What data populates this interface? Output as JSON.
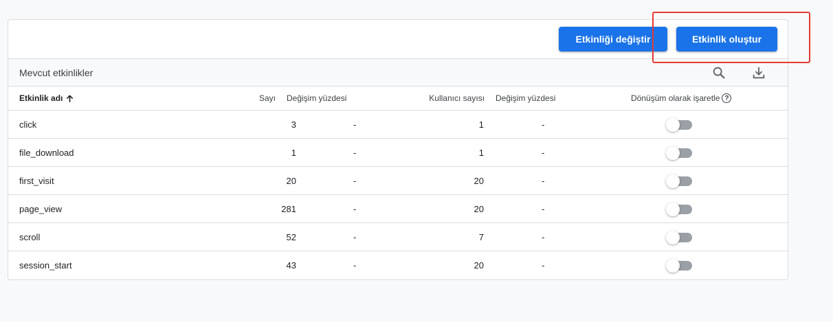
{
  "toolbar": {
    "modify_label": "Etkinliği değiştir",
    "create_label": "Etkinlik oluştur"
  },
  "section": {
    "title": "Mevcut etkinlikler"
  },
  "table": {
    "headers": {
      "name": "Etkinlik adı",
      "count": "Sayı",
      "count_change": "Değişim yüzdesi",
      "users": "Kullanıcı sayısı",
      "users_change": "Değişim yüzdesi",
      "conversion": "Dönüşüm olarak işaretle",
      "help": "?"
    },
    "rows": [
      {
        "name": "click",
        "count": "3",
        "count_change": "-",
        "users": "1",
        "users_change": "-",
        "conversion": false
      },
      {
        "name": "file_download",
        "count": "1",
        "count_change": "-",
        "users": "1",
        "users_change": "-",
        "conversion": false
      },
      {
        "name": "first_visit",
        "count": "20",
        "count_change": "-",
        "users": "20",
        "users_change": "-",
        "conversion": false
      },
      {
        "name": "page_view",
        "count": "281",
        "count_change": "-",
        "users": "20",
        "users_change": "-",
        "conversion": false
      },
      {
        "name": "scroll",
        "count": "52",
        "count_change": "-",
        "users": "7",
        "users_change": "-",
        "conversion": false
      },
      {
        "name": "session_start",
        "count": "43",
        "count_change": "-",
        "users": "20",
        "users_change": "-",
        "conversion": false
      }
    ]
  },
  "colors": {
    "primary": "#1a73e8",
    "highlight": "#e53935",
    "toggle_off": "#9aa0a6"
  },
  "icons": {
    "search": "search-icon",
    "download": "download-icon",
    "sort": "arrow-up-icon",
    "help": "help-icon"
  }
}
